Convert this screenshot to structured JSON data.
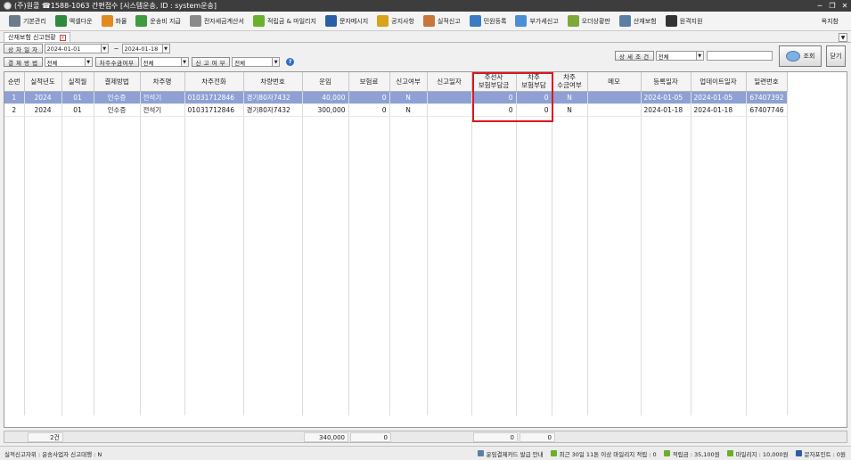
{
  "window": {
    "title": "(주)원콜 ☎1588-1063 간편접수 [시스템운송, ID : system운송]",
    "minimize": "─",
    "restore": "❐",
    "close": "✕"
  },
  "toolbar": {
    "items": [
      {
        "label": "기본관리",
        "icon": "gear-icon",
        "color": "#6b7b8c"
      },
      {
        "label": "엑셀다운",
        "icon": "excel-icon",
        "color": "#2e8b3e"
      },
      {
        "label": "화물",
        "icon": "cargo-icon",
        "color": "#e38a1e"
      },
      {
        "label": "운송비 지급",
        "icon": "money-icon",
        "color": "#3f9b3f"
      },
      {
        "label": "전자세금계산서",
        "icon": "invoice-icon",
        "color": "#8a8a8a"
      },
      {
        "label": "적립금 & 마일리지",
        "icon": "coin-icon",
        "color": "#6bb02b"
      },
      {
        "label": "문자메시지",
        "icon": "phone-icon",
        "color": "#2a5fa8"
      },
      {
        "label": "공지사항",
        "icon": "notice-icon",
        "color": "#d9a21a"
      },
      {
        "label": "실적신고",
        "icon": "report-icon",
        "color": "#c8763a"
      },
      {
        "label": "민원등록",
        "icon": "complaint-icon",
        "color": "#3b7bc5"
      },
      {
        "label": "부가세신고",
        "icon": "vat-icon",
        "color": "#4a8ed6"
      },
      {
        "label": "오더상황판",
        "icon": "map-pin-icon",
        "color": "#7fa83a"
      },
      {
        "label": "산재보험",
        "icon": "calendar-icon",
        "color": "#5a7fa6"
      },
      {
        "label": "원격지원",
        "icon": "monitor-icon",
        "color": "#333333"
      }
    ],
    "right_label": "옥지참"
  },
  "tab": {
    "label": "산재보험 신고현황"
  },
  "filters": {
    "date_label": "상 차 일 자",
    "date_from": "2024-01-01",
    "date_to": "2024-01-18",
    "payment_label": "결 제 방 법",
    "payment_value": "전체",
    "owner_fee_label": "차주수금여부",
    "owner_fee_value": "전체",
    "report_label": "신 고 여 부",
    "report_value": "전체",
    "detail_label": "상 세 조 건",
    "detail_value": "전체",
    "detail_text": ""
  },
  "buttons": {
    "search": "조회",
    "close": "닫기"
  },
  "table": {
    "columns": [
      "순번",
      "실적년도",
      "실적월",
      "결제방법",
      "차주명",
      "차주전화",
      "차량번호",
      "운임",
      "보험료",
      "신고여부",
      "신고일자",
      "주선사\n보험부담금",
      "차주\n보험부담",
      "차주\n수금여부",
      "메모",
      "등록일자",
      "업데이트일자",
      "일련번호"
    ],
    "rows": [
      [
        "1",
        "2024",
        "01",
        "인수증",
        "전석기",
        "01031712846",
        "경기80자7432",
        "40,000",
        "0",
        "N",
        "",
        "0",
        "0",
        "N",
        "",
        "2024-01-05",
        "2024-01-05",
        "67407392"
      ],
      [
        "2",
        "2024",
        "01",
        "인수증",
        "전석기",
        "01031712846",
        "경기80자7432",
        "300,000",
        "0",
        "N",
        "",
        "0",
        "0",
        "N",
        "",
        "2024-01-18",
        "2024-01-18",
        "67407746"
      ]
    ]
  },
  "summary": {
    "count": "2건",
    "fare_total": "340,000",
    "insurance_total": "0",
    "broker_total": "0",
    "owner_total": "0"
  },
  "status": {
    "left": "실적신고자위 : 운송사업자   신고대행 : N",
    "items": [
      {
        "label": "운임결제카드 발급 안내",
        "color": "#5a7fa6"
      },
      {
        "label": "최근 30일 11톤 이상 마일리지 적립 : 0",
        "color": "#6bb02b"
      },
      {
        "label": "적립금 : 35,100원",
        "color": "#6bb02b"
      },
      {
        "label": "마일리지 : 10,000원",
        "color": "#6bb02b"
      },
      {
        "label": "문자포인트 : 0원",
        "color": "#2a5fa8"
      }
    ]
  }
}
